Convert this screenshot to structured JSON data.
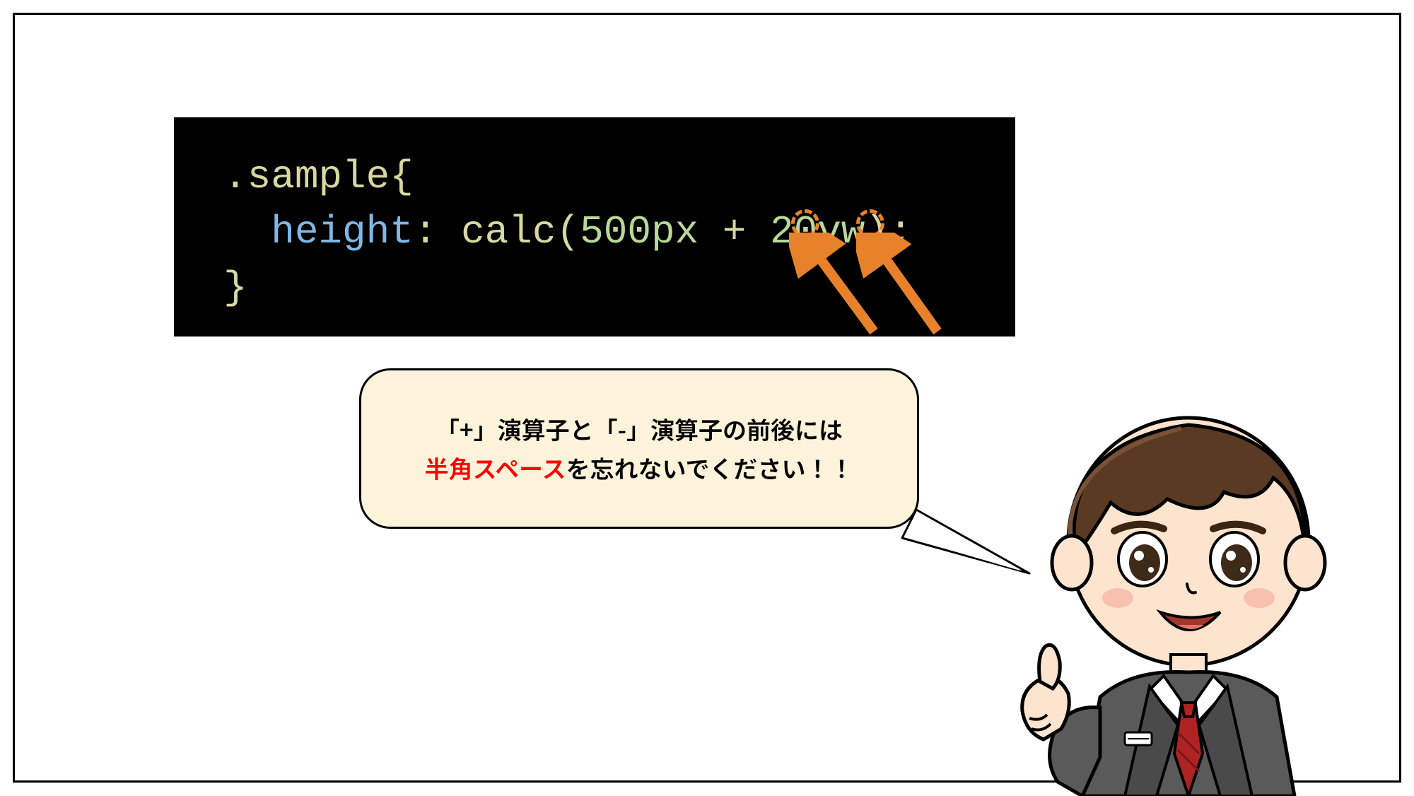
{
  "code": {
    "selector": ".sample",
    "open_brace": "{",
    "property": "height",
    "colon": ":",
    "func": "calc",
    "open_paren": "(",
    "val1_num": "500",
    "val1_unit": "px",
    "sp1": " ",
    "op": "+",
    "sp2": " ",
    "val2_num": "20",
    "val2_unit": "vw",
    "close_paren": ")",
    "semicolon": ";",
    "close_brace": "}"
  },
  "bubble": {
    "line1": "「+」演算子と「-」演算子の前後には",
    "line2_red": "半角スペース",
    "line2_rest": "を忘れないでください！！"
  }
}
